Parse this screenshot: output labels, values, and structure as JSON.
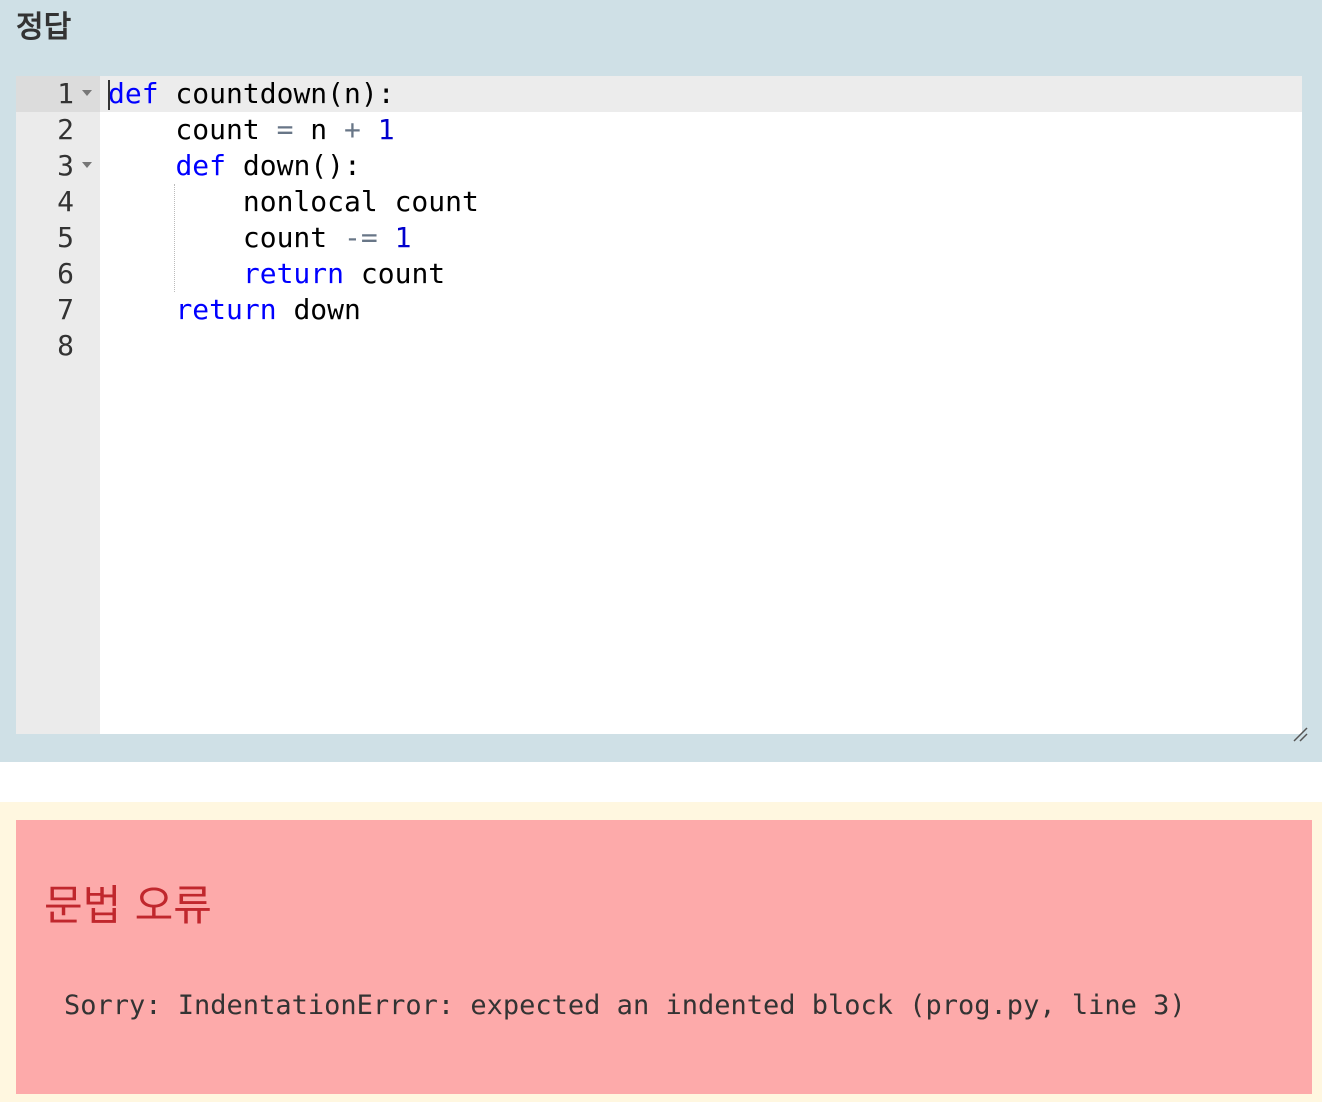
{
  "answer": {
    "title": "정답",
    "editor": {
      "line_numbers": [
        "1",
        "2",
        "3",
        "4",
        "5",
        "6",
        "7",
        "8"
      ],
      "active_line": 1,
      "fold_markers_on_lines": [
        1,
        3
      ],
      "lines": [
        [
          {
            "t": "def",
            "c": "kw"
          },
          {
            "t": " countdown(n):",
            "c": "p"
          }
        ],
        [
          {
            "t": "    count ",
            "c": "p"
          },
          {
            "t": "=",
            "c": "op"
          },
          {
            "t": " n ",
            "c": "p"
          },
          {
            "t": "+",
            "c": "op"
          },
          {
            "t": " ",
            "c": "p"
          },
          {
            "t": "1",
            "c": "num"
          }
        ],
        [
          {
            "t": "    ",
            "c": "p"
          },
          {
            "t": "def",
            "c": "kw"
          },
          {
            "t": " down():",
            "c": "p"
          }
        ],
        [
          {
            "t": "        nonlocal count",
            "c": "p"
          }
        ],
        [
          {
            "t": "        count ",
            "c": "p"
          },
          {
            "t": "-=",
            "c": "op"
          },
          {
            "t": " ",
            "c": "p"
          },
          {
            "t": "1",
            "c": "num"
          }
        ],
        [
          {
            "t": "        ",
            "c": "p"
          },
          {
            "t": "return",
            "c": "kw"
          },
          {
            "t": " count",
            "c": "p"
          }
        ],
        [
          {
            "t": "    ",
            "c": "p"
          },
          {
            "t": "return",
            "c": "kw"
          },
          {
            "t": " down",
            "c": "p"
          }
        ],
        []
      ],
      "colors": {
        "keyword": "#0000ff",
        "number": "#0000cd",
        "operator": "#687687"
      }
    }
  },
  "feedback": {
    "error_title": "문법 오류",
    "error_message": "Sorry: IndentationError: expected an indented block (prog.py, line 3)",
    "colors": {
      "box_background": "#fdaaaa",
      "title_color": "#c0272d"
    }
  }
}
